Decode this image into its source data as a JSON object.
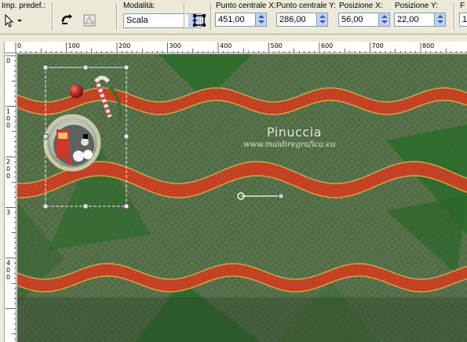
{
  "toolbar": {
    "preset_label": "Imp. predef.:",
    "mode_label": "Modalità:",
    "mode_value": "Scala",
    "center_x_label": "Punto centrale X:",
    "center_x_value": "451,00",
    "center_y_label": "Punto centrale Y:",
    "center_y_value": "286,00",
    "pos_x_label": "Posizione X:",
    "pos_x_value": "56,00",
    "pos_y_label": "Posizione Y:",
    "pos_y_value": "22,00",
    "cut_label": "F",
    "cut_value": "1"
  },
  "ruler_top": [
    "0",
    "100",
    "200",
    "300",
    "400",
    "500",
    "600",
    "700",
    "800"
  ],
  "ruler_left": [
    {
      "chars": "0"
    },
    {
      "chars": "1 0 0"
    },
    {
      "chars": "2 0 0"
    },
    {
      "chars": "3"
    },
    {
      "chars": "4 0 0"
    }
  ],
  "canvas": {
    "watermark_name": "Pinuccia",
    "watermark_url": "www.maidiregrafica.eu"
  },
  "colors": {
    "background_green": "#4d6b3a",
    "ribbon_red": "#b8331c",
    "ribbon_gold": "#c9a84a",
    "dark_green": "#1f6a24"
  },
  "icons": [
    "pointer-icon",
    "reset-icon",
    "deform-icon",
    "frame-icon"
  ]
}
